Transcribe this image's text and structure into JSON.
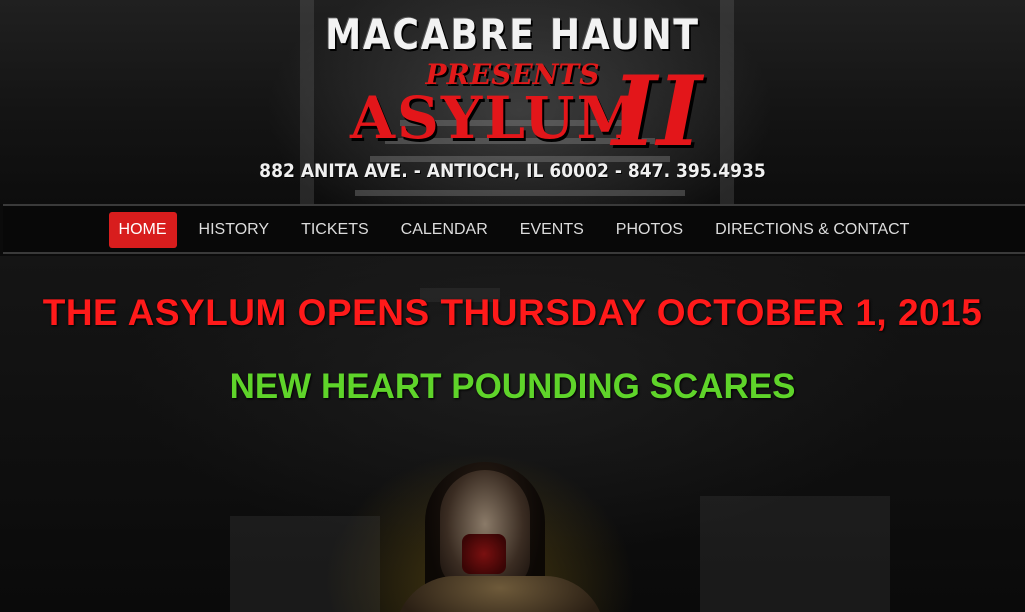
{
  "logo": {
    "line1": "MACABRE HAUNT",
    "line2": "PRESENTS",
    "line3": "ASYLUM",
    "line4": "II",
    "address": "882 ANITA AVE. - ANTIOCH, IL 60002 - 847. 395.4935"
  },
  "nav": {
    "items": [
      {
        "label": "HOME",
        "active": true
      },
      {
        "label": "HISTORY"
      },
      {
        "label": "TICKETS"
      },
      {
        "label": "CALENDAR"
      },
      {
        "label": "EVENTS"
      },
      {
        "label": "PHOTOS"
      },
      {
        "label": "DIRECTIONS & CONTACT"
      }
    ],
    "active_color": "#d81d1d"
  },
  "main": {
    "headline": "THE ASYLUM OPENS THURSDAY OCTOBER 1, 2015",
    "subheadline": "NEW HEART POUNDING SCARES",
    "headline_color": "#ff1a1a",
    "subheadline_color": "#5fd42a"
  }
}
